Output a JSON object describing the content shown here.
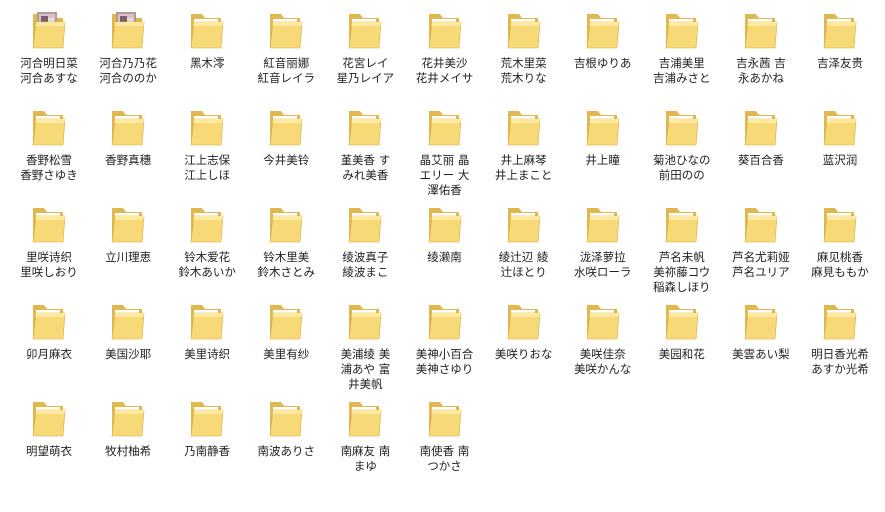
{
  "window": {
    "view": "explorer-large-icons"
  },
  "folders": [
    {
      "label": "河合明日菜\n河合あすな",
      "icon": "folder-photo-icon"
    },
    {
      "label": "河合乃乃花\n河合ののか",
      "icon": "folder-photo-icon"
    },
    {
      "label": "黑木澪",
      "icon": "folder-icon"
    },
    {
      "label": "紅音丽娜\n紅音レイラ",
      "icon": "folder-icon"
    },
    {
      "label": "花宮レイ\n星乃レイア",
      "icon": "folder-icon"
    },
    {
      "label": "花井美沙\n花井メイサ",
      "icon": "folder-icon"
    },
    {
      "label": "荒木里菜\n荒木りな",
      "icon": "folder-icon"
    },
    {
      "label": "吉根ゆりあ",
      "icon": "folder-icon"
    },
    {
      "label": "吉浦美里\n吉浦みさと",
      "icon": "folder-icon"
    },
    {
      "label": "吉永茜 吉\n永あかね",
      "icon": "folder-icon"
    },
    {
      "label": "吉泽友贵",
      "icon": "folder-icon"
    },
    {
      "label": "香野松雪\n香野さゆき",
      "icon": "folder-icon"
    },
    {
      "label": "香野真穗",
      "icon": "folder-icon"
    },
    {
      "label": "江上志保\n江上しほ",
      "icon": "folder-icon"
    },
    {
      "label": "今井美铃",
      "icon": "folder-icon"
    },
    {
      "label": "堇美香 す\nみれ美香",
      "icon": "folder-icon"
    },
    {
      "label": "晶艾丽 晶\nエリー 大\n澤佑香",
      "icon": "folder-icon"
    },
    {
      "label": "井上麻琴\n井上まこと",
      "icon": "folder-icon"
    },
    {
      "label": "井上瞳",
      "icon": "folder-icon"
    },
    {
      "label": "菊池ひなの\n前田のの",
      "icon": "folder-icon"
    },
    {
      "label": "葵百合香",
      "icon": "folder-icon"
    },
    {
      "label": "蓝沢润",
      "icon": "folder-icon"
    },
    {
      "label": "里咲诗织\n里咲しおり",
      "icon": "folder-icon"
    },
    {
      "label": "立川理恵",
      "icon": "folder-icon"
    },
    {
      "label": "铃木爱花\n鈴木あいか",
      "icon": "folder-icon"
    },
    {
      "label": "铃木里美\n鈴木さとみ",
      "icon": "folder-icon"
    },
    {
      "label": "绫波真子\n綾波まこ",
      "icon": "folder-icon"
    },
    {
      "label": "绫濑南",
      "icon": "folder-icon"
    },
    {
      "label": "绫辻辺 綾\n辻ほとり",
      "icon": "folder-icon"
    },
    {
      "label": "泷泽萝拉\n水咲ローラ",
      "icon": "folder-icon"
    },
    {
      "label": "芦名未帆\n美祢藤コウ\n稲森しほり",
      "icon": "folder-icon"
    },
    {
      "label": "芦名尤莉娅\n芦名ユリア",
      "icon": "folder-icon"
    },
    {
      "label": "麻见桃香\n麻見ももか",
      "icon": "folder-icon"
    },
    {
      "label": "卯月麻衣",
      "icon": "folder-icon"
    },
    {
      "label": "美国沙耶",
      "icon": "folder-icon"
    },
    {
      "label": "美里诗织",
      "icon": "folder-icon"
    },
    {
      "label": "美里有纱",
      "icon": "folder-icon"
    },
    {
      "label": "美浦绫 美\n浦あや 富\n井美帆",
      "icon": "folder-icon"
    },
    {
      "label": "美神小百合\n美神さゆり",
      "icon": "folder-icon"
    },
    {
      "label": "美咲りおな",
      "icon": "folder-icon"
    },
    {
      "label": "美咲佳奈\n美咲かんな",
      "icon": "folder-icon"
    },
    {
      "label": "美园和花",
      "icon": "folder-icon"
    },
    {
      "label": "美雲あい梨",
      "icon": "folder-icon"
    },
    {
      "label": "明日香光希\nあすか光希",
      "icon": "folder-icon"
    },
    {
      "label": "明望萌衣",
      "icon": "folder-icon"
    },
    {
      "label": "牧村柚希",
      "icon": "folder-icon"
    },
    {
      "label": "乃南静香",
      "icon": "folder-icon"
    },
    {
      "label": "南波ありさ",
      "icon": "folder-icon"
    },
    {
      "label": "南麻友 南\nまゆ",
      "icon": "folder-icon"
    },
    {
      "label": "南使香 南\nつかさ",
      "icon": "folder-icon"
    }
  ],
  "colors": {
    "folder_back": "#e0b84f",
    "folder_front": "#f8d978",
    "folder_front_light": "#fde99f",
    "folder_edge": "#d9a93c",
    "text": "#222222"
  }
}
